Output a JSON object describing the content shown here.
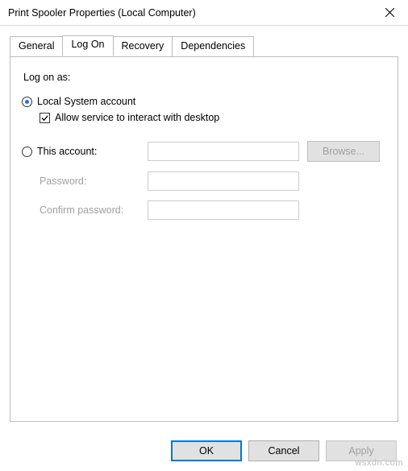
{
  "window": {
    "title": "Print Spooler Properties (Local Computer)"
  },
  "tabs": {
    "items": [
      {
        "label": "General"
      },
      {
        "label": "Log On"
      },
      {
        "label": "Recovery"
      },
      {
        "label": "Dependencies"
      }
    ],
    "active_index": 1
  },
  "panel": {
    "heading": "Log on as:",
    "local_system": {
      "label": "Local System account",
      "selected": true,
      "interact_label": "Allow service to interact with desktop",
      "interact_checked": true
    },
    "this_account": {
      "label": "This account:",
      "selected": false,
      "value": "",
      "browse_label": "Browse...",
      "password_label": "Password:",
      "password_value": "",
      "confirm_label": "Confirm password:",
      "confirm_value": ""
    }
  },
  "buttons": {
    "ok": "OK",
    "cancel": "Cancel",
    "apply": "Apply"
  },
  "watermark": "wsxdn.com"
}
